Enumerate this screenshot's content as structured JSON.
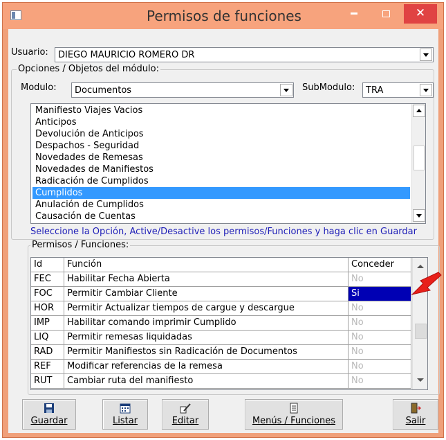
{
  "window": {
    "title": "Permisos de funciones",
    "minimize_glyph": "",
    "close_glyph": "✕"
  },
  "usuario": {
    "label": "Usuario:",
    "value": "DIEGO MAURICIO ROMERO DR"
  },
  "opciones": {
    "group_title": "Opciones / Objetos del módulo:",
    "modulo_label": "Modulo:",
    "modulo_value": "Documentos",
    "submodulo_label": "SubModulo:",
    "submodulo_value": "TRA",
    "items": [
      {
        "label": "Manifiesto Viajes Vacios"
      },
      {
        "label": "Anticipos"
      },
      {
        "label": "Devolución de Anticipos"
      },
      {
        "label": "Despachos - Seguridad"
      },
      {
        "label": "Novedades de Remesas"
      },
      {
        "label": "Novedades de Manifiestos"
      },
      {
        "label": "Radicación de Cumplidos"
      },
      {
        "label": "Cumplidos",
        "selected": true
      },
      {
        "label": "Anulación de Cumplidos"
      },
      {
        "label": "Causación de Cuentas"
      }
    ],
    "hint": "Seleccione la Opción, Active/Desactive los permisos/Funciones y haga clic en Guardar"
  },
  "permisos": {
    "group_title": "Permisos / Funciones:",
    "columns": {
      "id": "Id",
      "funcion": "Función",
      "conceder": "Conceder"
    },
    "rows": [
      {
        "id": "FEC",
        "funcion": "Habilitar Fecha Abierta",
        "conceder": "No"
      },
      {
        "id": "FOC",
        "funcion": "Permitir Cambiar Cliente",
        "conceder": "Si"
      },
      {
        "id": "HOR",
        "funcion": "Permitir Actualizar tiempos de cargue y descargue",
        "conceder": "No"
      },
      {
        "id": "IMP",
        "funcion": "Habilitar comando imprimir Cumplido",
        "conceder": "No"
      },
      {
        "id": "LIQ",
        "funcion": "Permitir remesas liquidadas",
        "conceder": "No"
      },
      {
        "id": "RAD",
        "funcion": "Permitir Manifiestos sin Radicación de Documentos",
        "conceder": "No"
      },
      {
        "id": "REF",
        "funcion": "Modificar referencias de la remesa",
        "conceder": "No"
      },
      {
        "id": "RUT",
        "funcion": "Cambiar ruta del manifiesto",
        "conceder": "No"
      }
    ]
  },
  "buttons": {
    "guardar": "Guardar",
    "listar": "Listar",
    "editar": "Editar",
    "menus": "Menús / Funciones",
    "salir": "Salir"
  },
  "colors": {
    "titlebar": "#f7a37d",
    "close": "#e04343",
    "list_selected": "#3399ff",
    "cell_selected": "#0000b4",
    "hint_text": "#1f1fb8",
    "pointer_arrow": "#e8201a"
  }
}
